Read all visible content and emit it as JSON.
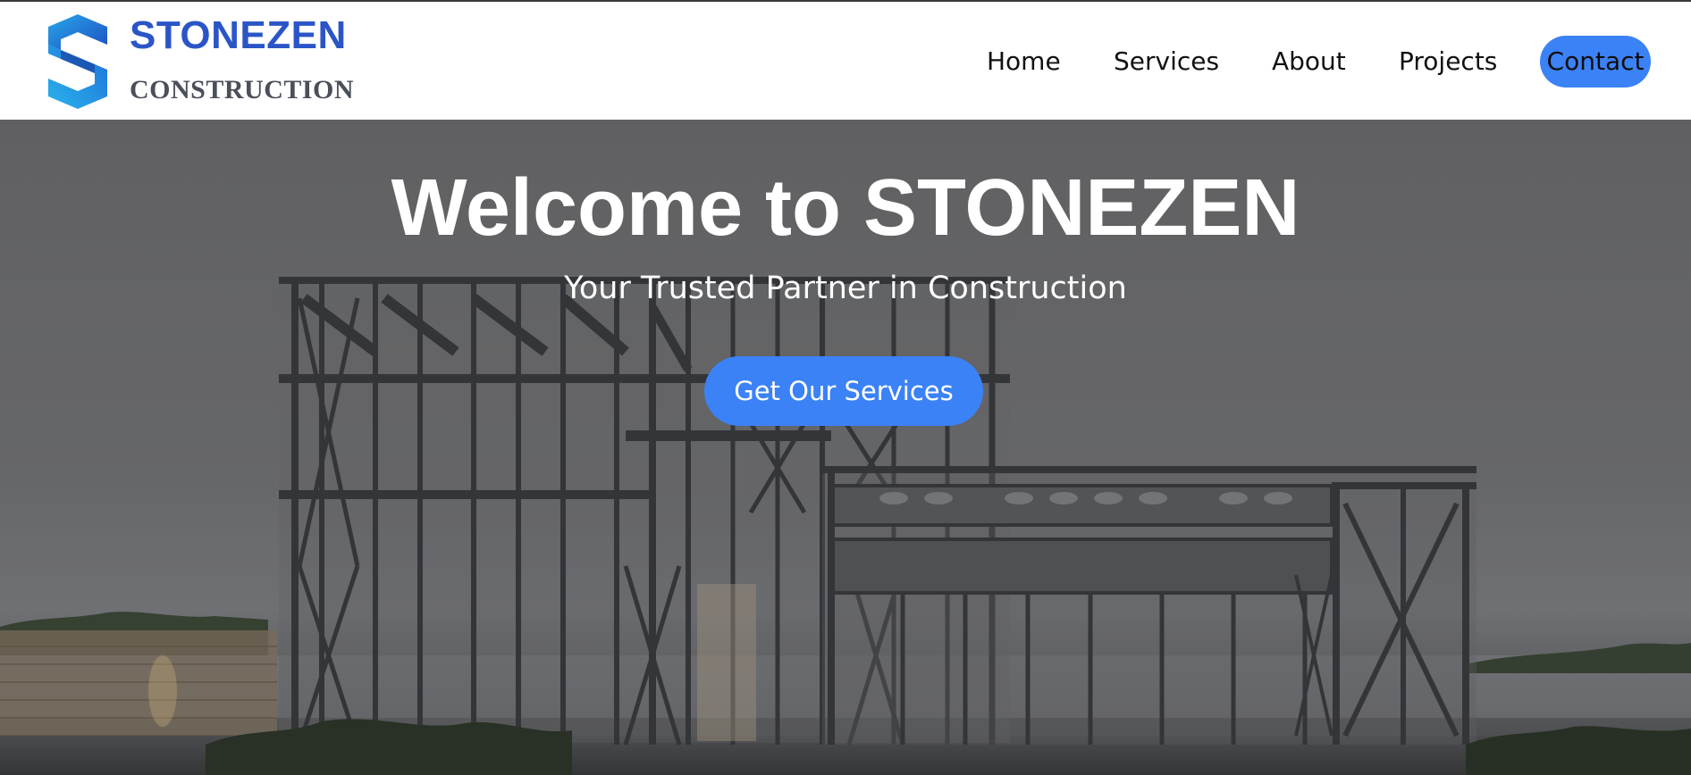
{
  "brand": {
    "name": "STONEZEN",
    "subtitle": "CONSTRUCTION",
    "logo_icon": "s-monogram-icon"
  },
  "nav": {
    "items": [
      {
        "label": "Home"
      },
      {
        "label": "Services"
      },
      {
        "label": "About"
      },
      {
        "label": "Projects"
      },
      {
        "label": "Contact"
      }
    ]
  },
  "hero": {
    "title": "Welcome to STONEZEN",
    "subtitle": "Your Trusted Partner in Construction",
    "cta_label": "Get Our Services"
  },
  "colors": {
    "brand_blue": "#2b55c7",
    "accent": "#3b82f6",
    "subtitle_gray": "#4a4f59"
  }
}
